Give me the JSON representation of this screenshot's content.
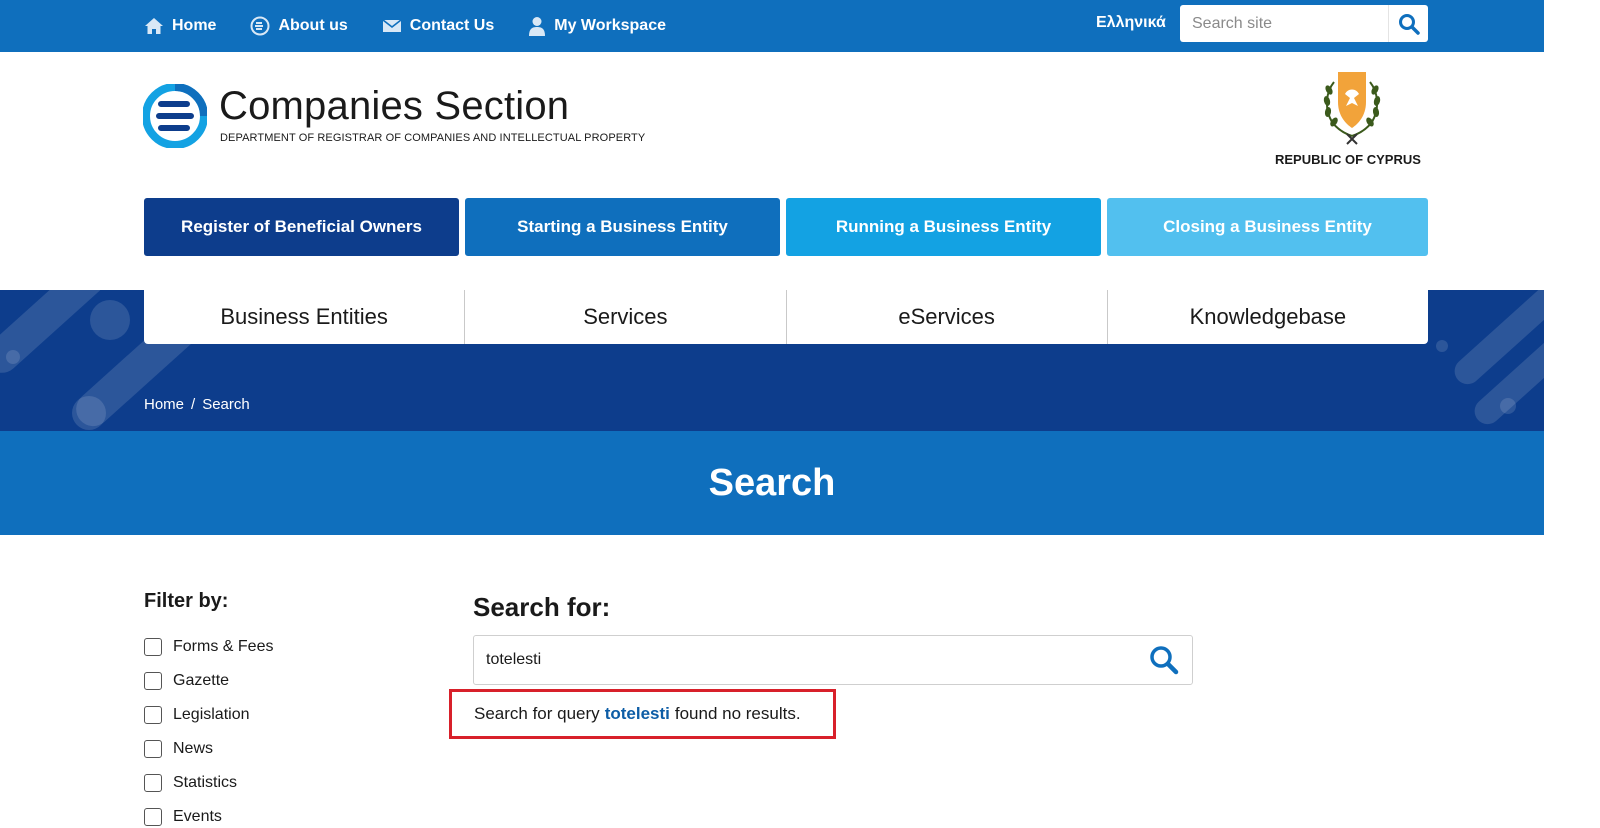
{
  "topnav": {
    "items": [
      {
        "label": "Home",
        "icon": "home-icon"
      },
      {
        "label": "About us",
        "icon": "about-icon"
      },
      {
        "label": "Contact Us",
        "icon": "envelope-icon"
      },
      {
        "label": "My Workspace",
        "icon": "user-icon"
      }
    ],
    "language": "Ελληνικά",
    "search_placeholder": "Search site"
  },
  "header": {
    "title": "Companies Section",
    "subtitle": "DEPARTMENT OF REGISTRAR OF COMPANIES AND INTELLECTUAL PROPERTY",
    "emblem_label": "REPUBLIC OF CYPRUS"
  },
  "category_buttons": [
    {
      "label": "Register of Beneficial Owners",
      "color": "#0d3d8c"
    },
    {
      "label": "Starting a Business Entity",
      "color": "#0f6fbd"
    },
    {
      "label": "Running a Business Entity",
      "color": "#13a2e3"
    },
    {
      "label": "Closing a Business Entity",
      "color": "#52c0ef"
    }
  ],
  "mainnav": [
    "Business Entities",
    "Services",
    "eServices",
    "Knowledgebase"
  ],
  "breadcrumb": {
    "home": "Home",
    "separator": "/",
    "current": "Search"
  },
  "page_title": "Search",
  "filters": {
    "heading": "Filter by:",
    "options": [
      "Forms & Fees",
      "Gazette",
      "Legislation",
      "News",
      "Statistics",
      "Events"
    ]
  },
  "search": {
    "heading": "Search for:",
    "value": "totelesti",
    "result_prefix": "Search for query",
    "result_query": "totelesti",
    "result_suffix": "found no results."
  },
  "colors": {
    "topbar": "#0f6fbd",
    "band": "#0d3d8c",
    "highlight_border": "#d8202a",
    "link": "#0d5da6"
  }
}
